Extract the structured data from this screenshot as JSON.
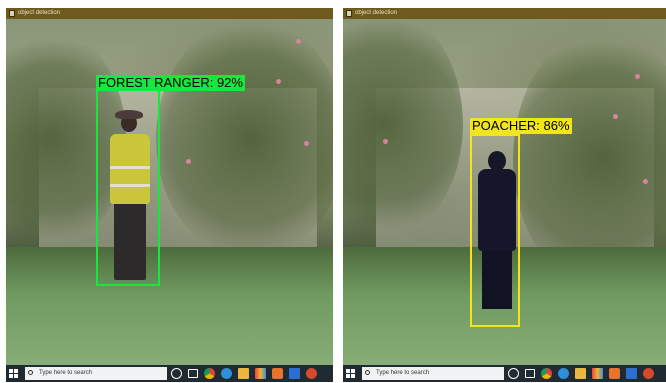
{
  "panels": [
    {
      "window_title": "object detection",
      "detection": {
        "label": "FOREST RANGER: 92%",
        "class": "FOREST RANGER",
        "confidence": "92%",
        "box_color": "#16e83c"
      },
      "taskbar": {
        "search_placeholder": "Type here to search"
      }
    },
    {
      "window_title": "object detection",
      "detection": {
        "label": "POACHER: 86%",
        "class": "POACHER",
        "confidence": "86%",
        "box_color": "#f2e51b"
      },
      "taskbar": {
        "search_placeholder": "Type here to search"
      }
    }
  ],
  "taskbar_icons": [
    "windows-start-icon",
    "search-icon",
    "cortana-circle-icon",
    "task-view-icon",
    "chrome-icon",
    "edge-icon",
    "file-explorer-icon",
    "photos-icon",
    "app-orange-icon",
    "app-blue-icon",
    "app-red-icon"
  ]
}
